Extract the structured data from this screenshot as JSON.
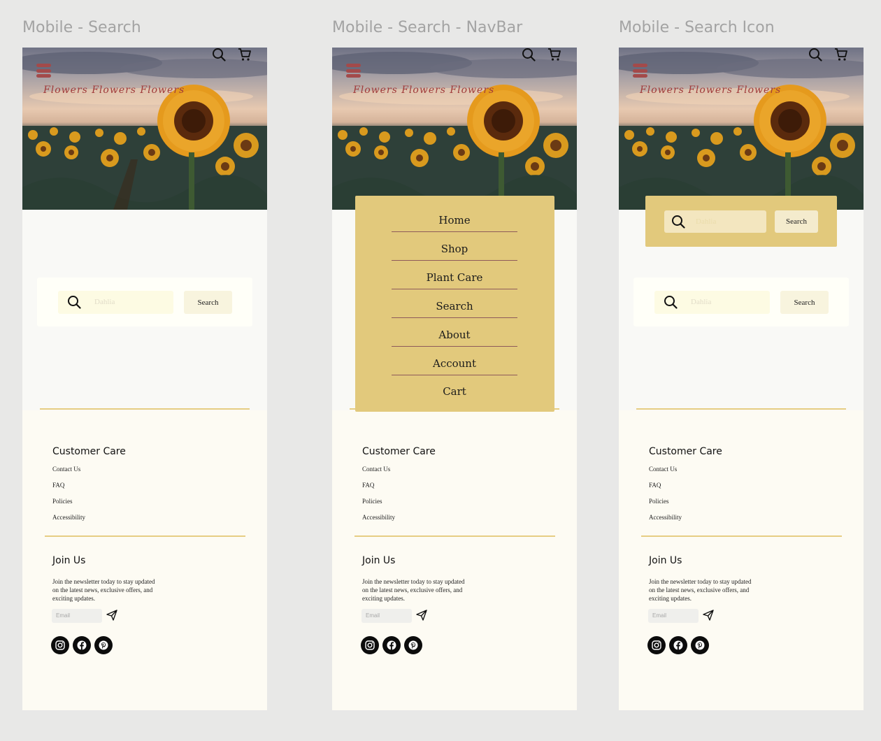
{
  "frames": [
    {
      "title": "Mobile - Search"
    },
    {
      "title": "Mobile - Search - NavBar"
    },
    {
      "title": "Mobile - Search Icon"
    }
  ],
  "header": {
    "brand": "Flowers Flowers Flowers",
    "menu_icon": "hamburger-icon",
    "search_icon": "search-icon",
    "cart_icon": "cart-icon"
  },
  "search": {
    "placeholder": "Dahlia",
    "button_label": "Search"
  },
  "nav": {
    "items": [
      "Home",
      "Shop",
      "Plant Care",
      "Search",
      "About",
      "Account",
      "Cart"
    ]
  },
  "footer": {
    "customer_care": {
      "heading": "Customer Care",
      "links": [
        "Contact Us",
        "FAQ",
        "Policies",
        "Accessibility"
      ]
    },
    "join": {
      "heading": "Join Us",
      "text": "Join the newsletter today to stay updated on the latest news, exclusive offers, and exciting updates.",
      "email_placeholder": "Email"
    },
    "social_icons": [
      "instagram-icon",
      "facebook-icon",
      "pinterest-icon"
    ]
  },
  "colors": {
    "accent_gold": "#e2c97c",
    "brand_red": "#a34a4a",
    "background": "#fdfbf3"
  }
}
